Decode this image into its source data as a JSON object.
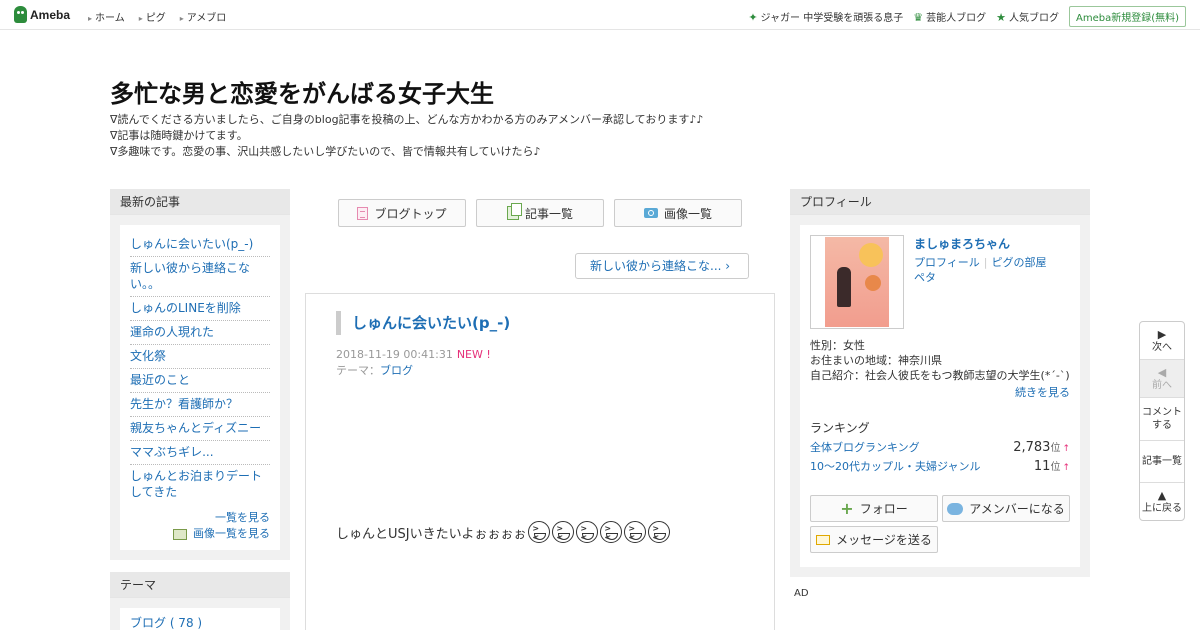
{
  "topbar": {
    "logo": "Ameba",
    "nav": [
      "ホーム",
      "ピグ",
      "アメブロ"
    ],
    "right_links": [
      "ジャガー 中学受験を頑張る息子",
      "芸能人ブログ",
      "人気ブログ"
    ],
    "register": "Ameba新規登録(無料)"
  },
  "header": {
    "title": "多忙な男と恋愛をがんばる女子大生",
    "desc": [
      "∇読んでくださる方いましたら、ご自身のblog記事を投稿の上、どんな方かわかる方のみアメンバー承認しております♪♪",
      "∇記事は随時鍵かけてます。",
      "∇多趣味です。恋愛の事、沢山共感したいし学びたいので、皆で情報共有していけたら♪"
    ]
  },
  "left": {
    "recent_head": "最新の記事",
    "recent": [
      "しゅんに会いたい(p_-)",
      "新しい彼から連絡こない。。",
      "しゅんのLINEを削除",
      "運命の人現れた",
      "文化祭",
      "最近のこと",
      "先生か？看護師か？",
      "親友ちゃんとディズニー",
      "ママぶちギレ...",
      "しゅんとお泊まりデートしてきた"
    ],
    "see_list": "一覧を見る",
    "see_images": "画像一覧を見る",
    "theme_head": "テーマ",
    "themes": [
      "ブログ ( 78 )"
    ]
  },
  "center": {
    "btn_top": "ブログトップ",
    "btn_list": "記事一覧",
    "btn_images": "画像一覧",
    "next_post": "新しい彼から連絡こな...",
    "article": {
      "title": "しゅんに会いたい(p_-)",
      "date": "2018-11-19 00:41:31",
      "new": "NEW !",
      "theme_label": "テーマ：",
      "theme": "ブログ",
      "body": "しゅんとUSJいきたいよぉぉぉぉ"
    }
  },
  "right": {
    "head": "プロフィール",
    "name": "ましゅまろちゃん",
    "link_profile": "プロフィール",
    "link_pig": "ピグの部屋",
    "link_peta": "ペタ",
    "gender": "性別：女性",
    "location": "お住まいの地域：神奈川県",
    "intro": "自己紹介：社会人彼氏をもつ教師志望の大学生(*´-`)",
    "readmore": "続きを見る",
    "ranking_title": "ランキング",
    "rankings": [
      {
        "label": "全体ブログランキング",
        "rank": "2,783",
        "unit": "位"
      },
      {
        "label": "10〜20代カップル・夫婦ジャンル",
        "rank": "11",
        "unit": "位"
      }
    ],
    "follow": "フォロー",
    "amember": "アメンバーになる",
    "message": "メッセージを送る",
    "ad": "AD"
  },
  "sidenav": {
    "next": "次へ",
    "prev": "前へ",
    "comment": "コメントする",
    "list": "記事一覧",
    "top": "上に戻る"
  }
}
